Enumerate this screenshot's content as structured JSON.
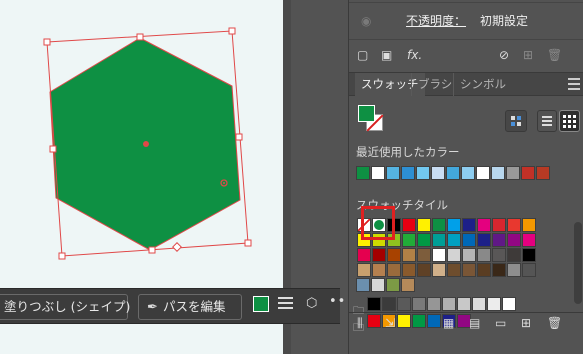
{
  "canvas": {
    "shape_fill": "#0e9043",
    "bbox_color": "#e04848"
  },
  "context_bar": {
    "fill_button": "塗りつぶし (シェイプ)",
    "path_button": "パスを編集",
    "more": "•••"
  },
  "appearance": {
    "opacity_label": "不透明度：",
    "opacity_value": "初期設定",
    "fx_label": "fx."
  },
  "tabs": [
    "スウォッチ",
    "ブラシ",
    "シンボル"
  ],
  "sections": {
    "recent": "最近使用したカラー",
    "tiles": "スウォッチタイル"
  },
  "recent_colors": [
    "#0e9043",
    "#ffffff",
    "#55b4e2",
    "#2d8fd3",
    "#72c8f0",
    "#c9ddf3",
    "#43a8dc",
    "#8dcdf0",
    "#ffffff",
    "#b8d7ee",
    "#999999",
    "#c23127",
    "#b73a24"
  ],
  "swatch_rows": [
    [
      "none",
      "#ffffff",
      "#000000",
      "#e60012",
      "#fff100",
      "#0e9043",
      "#00a0e9",
      "#1d2088",
      "#e4007f",
      "#d7262f",
      "#e8382f",
      "#f39800"
    ],
    [
      "#fff100",
      "#cfdb00",
      "#8fc31f",
      "#22ac38",
      "#009944",
      "#009e96",
      "#00a0c1",
      "#0068b7",
      "#1d2088",
      "#601986",
      "#920783",
      "#e4007f"
    ],
    [
      "#e5004f",
      "#a40000",
      "#a84200",
      "#b28146",
      "#7d5d3c",
      "#ffffff",
      "#d3d3d3",
      "#b5b5b5",
      "#898989",
      "#595757",
      "#3e3a39",
      "#000000"
    ],
    [
      "#c8a06e",
      "#b5804f",
      "#9a6b3c",
      "#8a5a2c",
      "#5f4126",
      "#d0b08a",
      "#6e4d2d",
      "#7a5636",
      "#5a3d22",
      "#3a2818",
      "#8e8e8e",
      "#555555"
    ]
  ],
  "pattern_row": [
    "#6b8fae",
    "#d8d8d8",
    "#7c9a45",
    "#b58a5a"
  ],
  "group1": [
    "#000000",
    "#3b3b3b",
    "#5a5a5a",
    "#7a7a7a",
    "#969696",
    "#b0b0b0",
    "#c8c8c8",
    "#dcdcdc",
    "#ececec",
    "#ffffff"
  ],
  "group2": [
    "#e60012",
    "#f39800",
    "#fff100",
    "#009944",
    "#0068b7",
    "#1d2088",
    "#920783"
  ]
}
